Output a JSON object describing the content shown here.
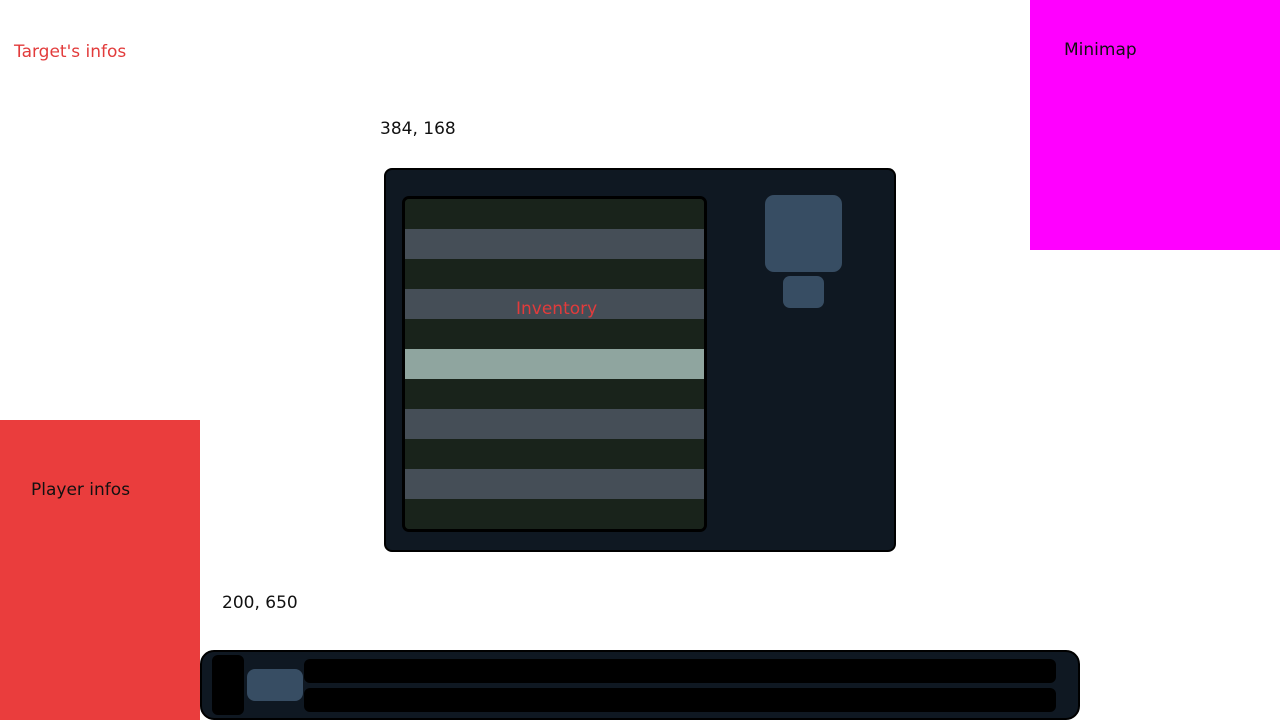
{
  "target": {
    "label": "Target's infos"
  },
  "minimap": {
    "label": "Minimap",
    "color": "#ff00ff"
  },
  "inventory": {
    "coords_label": "384, 168",
    "label": "Inventory",
    "selected_row": 5,
    "row_count": 11
  },
  "player": {
    "label": "Player infos",
    "color": "#ea3d3d"
  },
  "action_bar": {
    "coords_label": "200, 650"
  }
}
